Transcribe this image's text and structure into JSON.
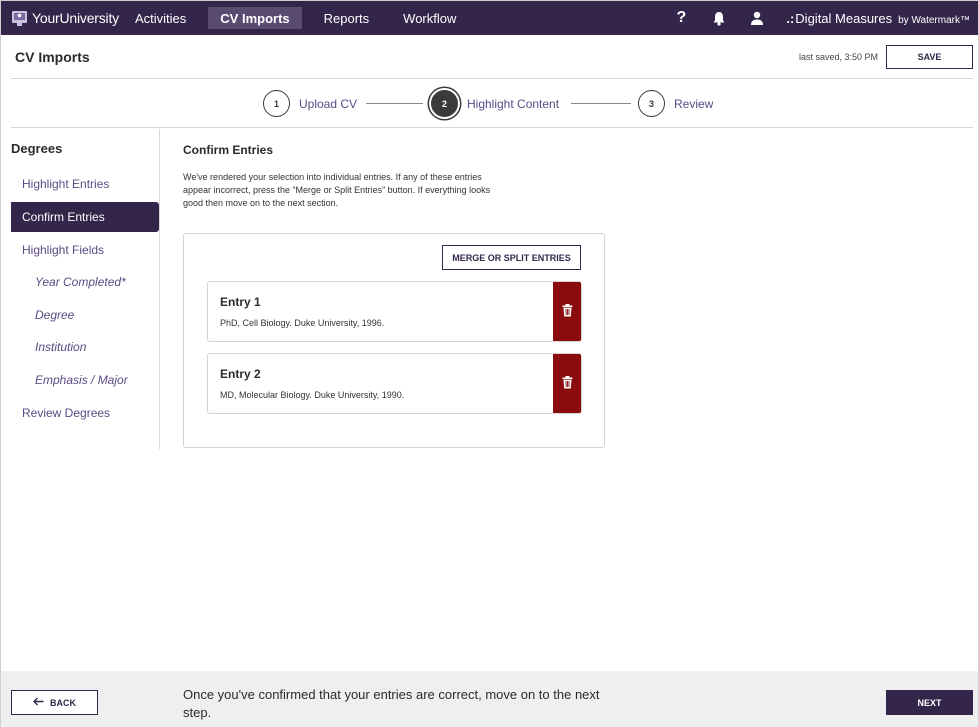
{
  "nav": {
    "brand": "YourUniversity",
    "items": [
      {
        "label": "Activities",
        "active": false
      },
      {
        "label": "CV Imports",
        "active": true
      },
      {
        "label": "Reports",
        "active": false
      },
      {
        "label": "Workflow",
        "active": false
      }
    ],
    "help_glyph": "?",
    "icons": [
      "help-icon",
      "bell-icon",
      "user-icon"
    ],
    "vendor": {
      "dots": ".:",
      "name": "Digital Measures",
      "by": "by Watermark™"
    }
  },
  "header": {
    "title": "CV Imports",
    "last_saved": "last saved, 3:50 PM",
    "save_label": "SAVE"
  },
  "stepper": {
    "steps": [
      {
        "number": "1",
        "label": "Upload CV",
        "state": "done"
      },
      {
        "number": "2",
        "label": "Highlight Content",
        "state": "current"
      },
      {
        "number": "3",
        "label": "Review",
        "state": "upcoming"
      }
    ]
  },
  "sidebar": {
    "title": "Degrees",
    "items": [
      {
        "label": "Highlight Entries",
        "level": 1,
        "active": false
      },
      {
        "label": "Confirm Entries",
        "level": 1,
        "active": true
      },
      {
        "label": "Highlight Fields",
        "level": 1,
        "active": false
      },
      {
        "label": "Year Completed*",
        "level": 2,
        "active": false
      },
      {
        "label": "Degree",
        "level": 2,
        "active": false
      },
      {
        "label": "Institution",
        "level": 2,
        "active": false
      },
      {
        "label": "Emphasis / Major",
        "level": 2,
        "active": false
      },
      {
        "label": "Review Degrees",
        "level": 1,
        "active": false
      }
    ]
  },
  "main": {
    "title": "Confirm Entries",
    "description": "We've rendered your selection into individual entries. If any of these entries appear incorrect, press the “Merge or Split Entries” button. If everything looks good then move on to the next section.",
    "merge_label": "MERGE OR SPLIT ENTRIES",
    "entries": [
      {
        "name": "Entry 1",
        "detail": "PhD, Cell Biology. Duke University, 1996."
      },
      {
        "name": "Entry 2",
        "detail": "MD, Molecular Biology. Duke University, 1990."
      }
    ]
  },
  "footer": {
    "back_label": "BACK",
    "message": "Once you've confirmed that your entries are correct, move on to the next step.",
    "next_label": "NEXT"
  },
  "colors": {
    "primary": "#33264a",
    "nav_active": "#5a4b72",
    "link": "#5b4a85",
    "danger": "#8a0c0c",
    "footer_bg": "#efefef"
  }
}
